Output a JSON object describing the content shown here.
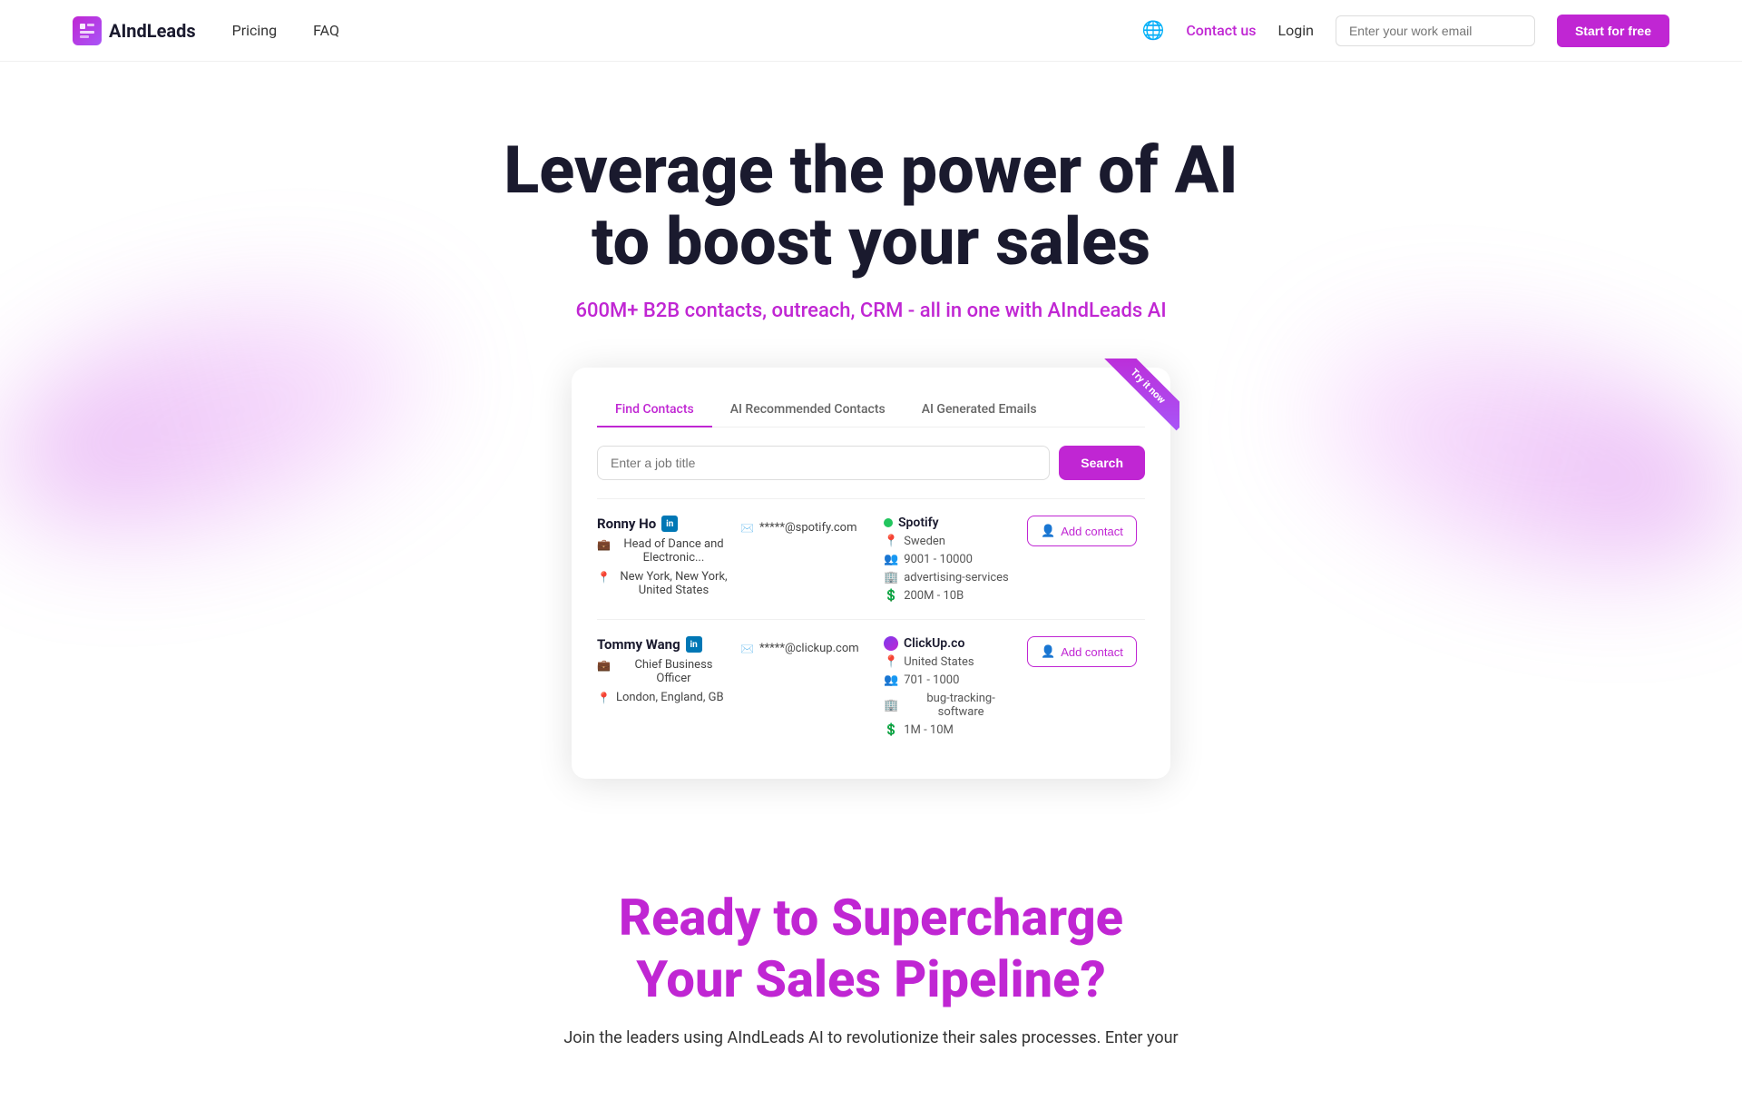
{
  "navbar": {
    "logo_text": "AIndLeads",
    "logo_icon": "AI",
    "nav_links": [
      {
        "label": "Pricing",
        "id": "pricing"
      },
      {
        "label": "FAQ",
        "id": "faq"
      }
    ],
    "contact_us": "Contact us",
    "login": "Login",
    "email_placeholder": "Enter your work email",
    "start_btn": "Start for free"
  },
  "hero": {
    "title_line1": "Leverage the power of AI",
    "title_line2": "to boost your sales",
    "subtitle": "600M+ B2B contacts, outreach, CRM - all in one with AIndLeads AI"
  },
  "demo": {
    "ribbon": "Try it now",
    "tabs": [
      {
        "label": "Find Contacts",
        "active": true
      },
      {
        "label": "AI Recommended Contacts",
        "active": false
      },
      {
        "label": "AI Generated Emails",
        "active": false
      }
    ],
    "search_placeholder": "Enter a job title",
    "search_btn": "Search",
    "contacts": [
      {
        "name": "Ronny Ho",
        "email": "*****@spotify.com",
        "role": "Head of Dance and Electronic...",
        "location": "New York, New York, United States",
        "company": "Spotify",
        "company_dot": "green",
        "country": "Sweden",
        "employees": "9001 - 10000",
        "revenue": "200M - 10B",
        "industry": "advertising-services",
        "add_btn": "Add contact"
      },
      {
        "name": "Tommy Wang",
        "email": "*****@clickup.com",
        "role": "Chief Business Officer",
        "location": "London, England, GB",
        "company": "ClickUp.co",
        "company_dot": "clickup",
        "country": "United States",
        "employees": "701 - 1000",
        "revenue": "1M - 10M",
        "industry": "bug-tracking-software",
        "add_btn": "Add contact"
      }
    ]
  },
  "bottom": {
    "title_line1": "Ready to Supercharge",
    "title_line2": "Your Sales Pipeline?",
    "subtitle": "Join the leaders using AIndLeads AI to revolutionize their sales processes. Enter your"
  }
}
